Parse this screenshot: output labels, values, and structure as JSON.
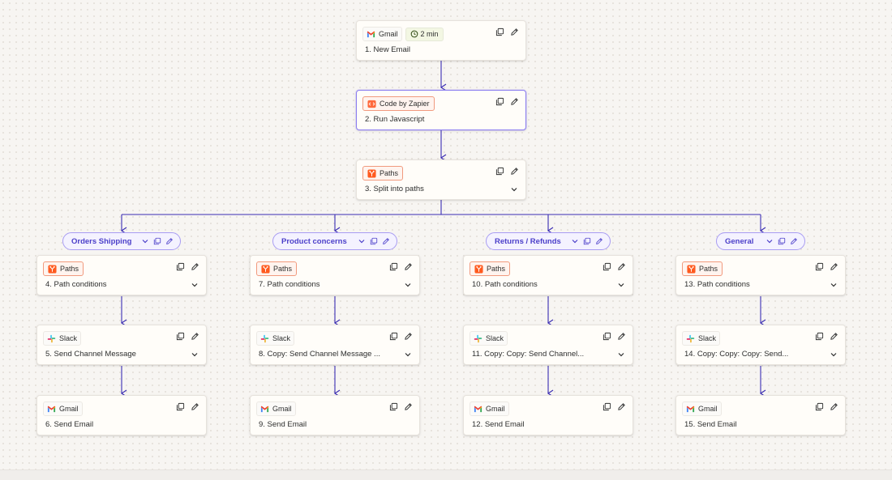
{
  "colors": {
    "connector": "#3b2db3",
    "accent": "#7b6cf6",
    "paths_orange": "#f0643a",
    "timer_bg": "#f3f7e3"
  },
  "top_steps": [
    {
      "app": "Gmail",
      "app_icon": "gmail-icon",
      "badge": "2 min",
      "title": "1. New Email"
    },
    {
      "app": "Code by Zapier",
      "app_icon": "code-icon",
      "title": "2. Run Javascript"
    },
    {
      "app": "Paths",
      "app_icon": "paths-icon",
      "title": "3. Split into paths"
    }
  ],
  "branches": [
    {
      "name": "Orders Shipping",
      "steps": [
        {
          "app": "Paths",
          "app_icon": "paths-icon",
          "title": "4. Path conditions"
        },
        {
          "app": "Slack",
          "app_icon": "slack-icon",
          "title": "5. Send Channel Message"
        },
        {
          "app": "Gmail",
          "app_icon": "gmail-icon",
          "title": "6. Send Email"
        }
      ]
    },
    {
      "name": "Product concerns",
      "steps": [
        {
          "app": "Paths",
          "app_icon": "paths-icon",
          "title": "7. Path conditions"
        },
        {
          "app": "Slack",
          "app_icon": "slack-icon",
          "title": "8. Copy: Send Channel Message ..."
        },
        {
          "app": "Gmail",
          "app_icon": "gmail-icon",
          "title": "9. Send Email"
        }
      ]
    },
    {
      "name": "Returns / Refunds",
      "steps": [
        {
          "app": "Paths",
          "app_icon": "paths-icon",
          "title": "10. Path conditions"
        },
        {
          "app": "Slack",
          "app_icon": "slack-icon",
          "title": "11. Copy: Copy: Send Channel..."
        },
        {
          "app": "Gmail",
          "app_icon": "gmail-icon",
          "title": "12. Send Email"
        }
      ]
    },
    {
      "name": "General",
      "steps": [
        {
          "app": "Paths",
          "app_icon": "paths-icon",
          "title": "13. Path conditions"
        },
        {
          "app": "Slack",
          "app_icon": "slack-icon",
          "title": "14. Copy: Copy: Copy: Send..."
        },
        {
          "app": "Gmail",
          "app_icon": "gmail-icon",
          "title": "15. Send Email"
        }
      ]
    }
  ]
}
